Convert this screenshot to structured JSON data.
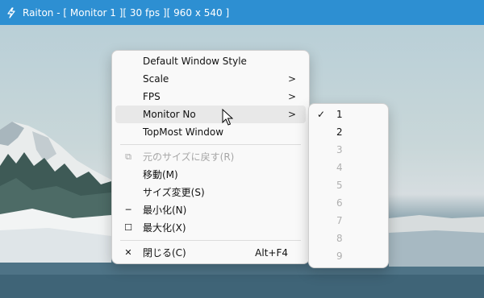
{
  "window": {
    "title": "Raiton - [ Monitor 1 ][ 30 fps ][ 960 x 540 ]",
    "titlebar_color": "#2d8fd2",
    "icon": "lightning-icon"
  },
  "main_menu": {
    "items": [
      {
        "label": "Default Window Style"
      },
      {
        "label": "Scale",
        "arrow": ">"
      },
      {
        "label": "FPS",
        "arrow": ">"
      },
      {
        "label": "Monitor No",
        "arrow": ">"
      },
      {
        "label": "TopMost Window"
      }
    ],
    "system_items": [
      {
        "label": "元のサイズに戻す(R)",
        "icon": "restore-icon",
        "glyph": "⧉"
      },
      {
        "label": "移動(M)"
      },
      {
        "label": "サイズ変更(S)"
      },
      {
        "label": "最小化(N)",
        "icon": "minimize-icon",
        "glyph": "─"
      },
      {
        "label": "最大化(X)",
        "icon": "maximize-icon",
        "glyph": "☐"
      },
      {
        "label": "閉じる(C)",
        "icon": "close-icon",
        "glyph": "✕",
        "accelerator": "Alt+F4"
      }
    ]
  },
  "monitor_submenu": {
    "check_glyph": "✓",
    "items": [
      {
        "label": "1"
      },
      {
        "label": "2"
      },
      {
        "label": "3"
      },
      {
        "label": "4"
      },
      {
        "label": "5"
      },
      {
        "label": "6"
      },
      {
        "label": "7"
      },
      {
        "label": "8"
      },
      {
        "label": "9"
      }
    ]
  }
}
